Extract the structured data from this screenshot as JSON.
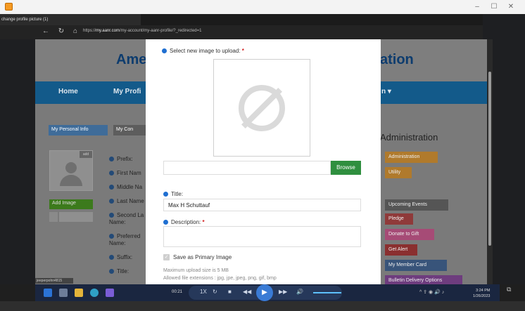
{
  "player": {
    "title_icon": "app-icon",
    "window_controls": [
      "–",
      "☐",
      "✕"
    ]
  },
  "browser": {
    "tab_title": "change profile picture (1)",
    "url_prefix": "https://",
    "url_domain": "my.aanr.com",
    "url_path": "/my-account/my-aanr-profile/?_redirected=1",
    "nav_icons": [
      "←",
      "↻",
      "⌂"
    ]
  },
  "site": {
    "logo_left": "Ame",
    "logo_right": "ation",
    "nav": [
      "Home",
      "My Profi",
      "n ▾"
    ],
    "tabs": {
      "personal": "My Personal Info",
      "contact": "My Con"
    },
    "avatar_edit": "add",
    "add_image": "Add Image",
    "fields": [
      "Prefix:",
      "First Nam",
      "Middle Na",
      "Last Name",
      "Second La",
      "Name:",
      "Preferred",
      "Name:",
      "Suffix:",
      "Title:"
    ],
    "admin_title": "Administration",
    "admin_buttons": [
      "Administration",
      "Utility",
      "Upcoming Events",
      "Pledge",
      "Donate to Gift",
      "Get Alert",
      "My Member Card",
      "Bulletin Delivery Options"
    ]
  },
  "modal": {
    "upload_label": "Select new image to upload:",
    "required_mark": "*",
    "browse_label": "Browse",
    "title_label": "Title:",
    "title_value": "Max H Schuttauf",
    "description_label": "Description:",
    "description_value": "",
    "primary_label": "Save as Primary Image",
    "max_size": "Maximum upload size is 5 MB",
    "allowed_ext": "Allowed file extensions : jpg, jpe, jpeg, png, gif, bmp"
  },
  "video": {
    "tooltip": "jeeperpohn4815",
    "time": "00:21",
    "speed": "1X",
    "controls": [
      "↻",
      "■",
      "◀◀",
      "▶",
      "▶▶",
      "🔊"
    ]
  },
  "taskbar": {
    "clock_time": "3:24 PM",
    "clock_date": "1/26/2023",
    "tray": "^  ⇪  ◉ 🔊  ♪"
  },
  "colors": {
    "nav_bar": "#135a8a",
    "browse_green": "#2f8f3f",
    "info_blue": "#1f6fd1",
    "required_red": "#d21f1f"
  }
}
